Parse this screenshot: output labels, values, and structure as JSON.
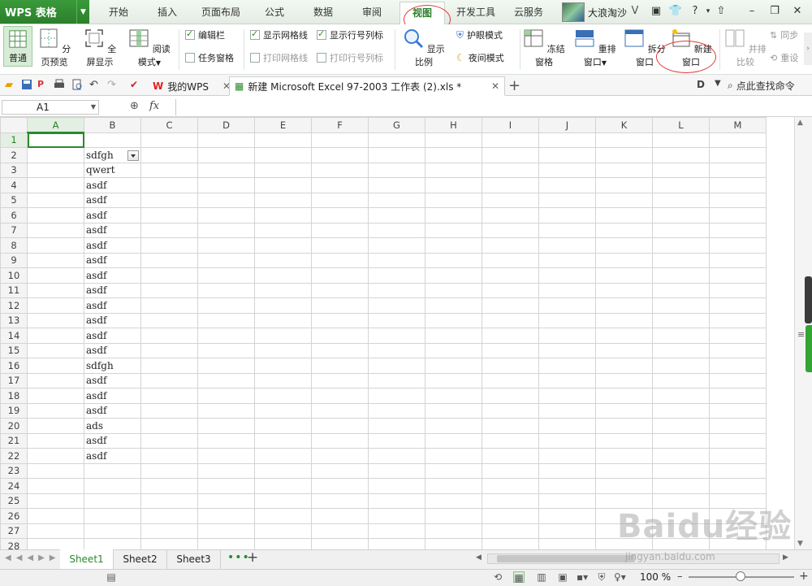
{
  "app": {
    "logo_text": "WPS 表格"
  },
  "menu": {
    "tabs": [
      "开始",
      "插入",
      "页面布局",
      "公式",
      "数据",
      "审阅",
      "视图",
      "开发工具",
      "云服务"
    ],
    "active": "视图"
  },
  "user": {
    "name": "大浪淘沙"
  },
  "ribbon": {
    "normal": "普通",
    "page_preview": "分页预览",
    "fullscreen": "全屏显示",
    "reading_mode": "阅读模式",
    "edit_bar": "编辑栏",
    "task_pane": "任务窗格",
    "show_gridlines": "显示网格线",
    "print_gridlines": "打印网格线",
    "show_headers": "显示行号列标",
    "print_headers": "打印行号列标",
    "zoom_ratio": "显示比例",
    "eye_mode": "护眼模式",
    "night_mode": "夜间模式",
    "freeze": "冻结窗格",
    "rearrange": "重排窗口",
    "split": "拆分窗口",
    "new_window": "新建窗口",
    "side_by_side": "并排比较",
    "sync": "同步",
    "reset": "重设"
  },
  "tabs": {
    "my_wps": "我的WPS",
    "file_name": "新建 Microsoft Excel 97-2003 工作表 (2).xls *",
    "search_cmd": "点此查找命令"
  },
  "formula_bar": {
    "cell_ref": "A1",
    "fx": "fx",
    "content": ""
  },
  "columns": [
    "A",
    "B",
    "C",
    "D",
    "E",
    "F",
    "G",
    "H",
    "I",
    "J",
    "K",
    "L",
    "M"
  ],
  "rows": [
    {
      "n": "1",
      "b": ""
    },
    {
      "n": "2",
      "b": "sdfgh"
    },
    {
      "n": "3",
      "b": "qwert"
    },
    {
      "n": "4",
      "b": "asdf"
    },
    {
      "n": "5",
      "b": "asdf"
    },
    {
      "n": "6",
      "b": "asdf"
    },
    {
      "n": "7",
      "b": "asdf"
    },
    {
      "n": "8",
      "b": "asdf"
    },
    {
      "n": "9",
      "b": "asdf"
    },
    {
      "n": "10",
      "b": "asdf"
    },
    {
      "n": "11",
      "b": "asdf"
    },
    {
      "n": "12",
      "b": "asdf"
    },
    {
      "n": "13",
      "b": "asdf"
    },
    {
      "n": "14",
      "b": "asdf"
    },
    {
      "n": "15",
      "b": "asdf"
    },
    {
      "n": "16",
      "b": "sdfgh"
    },
    {
      "n": "17",
      "b": "asdf"
    },
    {
      "n": "18",
      "b": "asdf"
    },
    {
      "n": "19",
      "b": "asdf"
    },
    {
      "n": "20",
      "b": "ads"
    },
    {
      "n": "21",
      "b": "asdf"
    },
    {
      "n": "22",
      "b": "asdf"
    },
    {
      "n": "23",
      "b": ""
    },
    {
      "n": "24",
      "b": ""
    },
    {
      "n": "25",
      "b": ""
    },
    {
      "n": "26",
      "b": ""
    },
    {
      "n": "27",
      "b": ""
    },
    {
      "n": "28",
      "b": ""
    }
  ],
  "sheets": [
    "Sheet1",
    "Sheet2",
    "Sheet3"
  ],
  "status": {
    "zoom": "100 %"
  },
  "watermark": {
    "main": "Baidu经验",
    "sub": "jingyan.baidu.com"
  },
  "colors": {
    "accent": "#2b8a2b",
    "annotation": "#e23a3a"
  }
}
